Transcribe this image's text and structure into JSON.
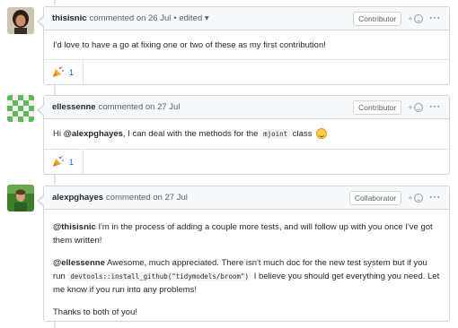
{
  "comments": [
    {
      "author": "thisisnic",
      "meta": "commented on 26 Jul",
      "edited": "• edited ▾",
      "role": "Contributor",
      "body": [
        "I'd love to have a go at fixing one or two of these as my first contribution!"
      ],
      "reaction_count": "1"
    },
    {
      "author": "ellessenne",
      "meta": "commented on 27 Jul",
      "role": "Contributor",
      "body_pre": "Hi ",
      "body_mention": "@alexpghayes",
      "body_mid": ", I can deal with the methods for the ",
      "body_code": "mjoint",
      "body_post": " class",
      "reaction_count": "1"
    },
    {
      "author": "alexpghayes",
      "meta": "commented on 27 Jul",
      "role": "Collaborator",
      "p1_mention": "@thisisnic",
      "p1_text": " I'm in the process of adding a couple more tests, and will follow up with you once I've got them written!",
      "p2_mention": "@ellessenne",
      "p2_text_a": " Awesome, much appreciated. There isn't much doc for the new test system but if you run ",
      "p2_code": "devtools::install_github(\"tidymodels/broom\")",
      "p2_text_b": " I believe you should get everything you need. Let me know if you run into any problems!",
      "p3_text": "Thanks to both of you!"
    }
  ],
  "ui": {
    "react_plus": "+",
    "kebab": "···"
  },
  "colors": {
    "link": "#0366d6",
    "header_bg": "#f6f8fa",
    "border": "#d1d5da"
  }
}
